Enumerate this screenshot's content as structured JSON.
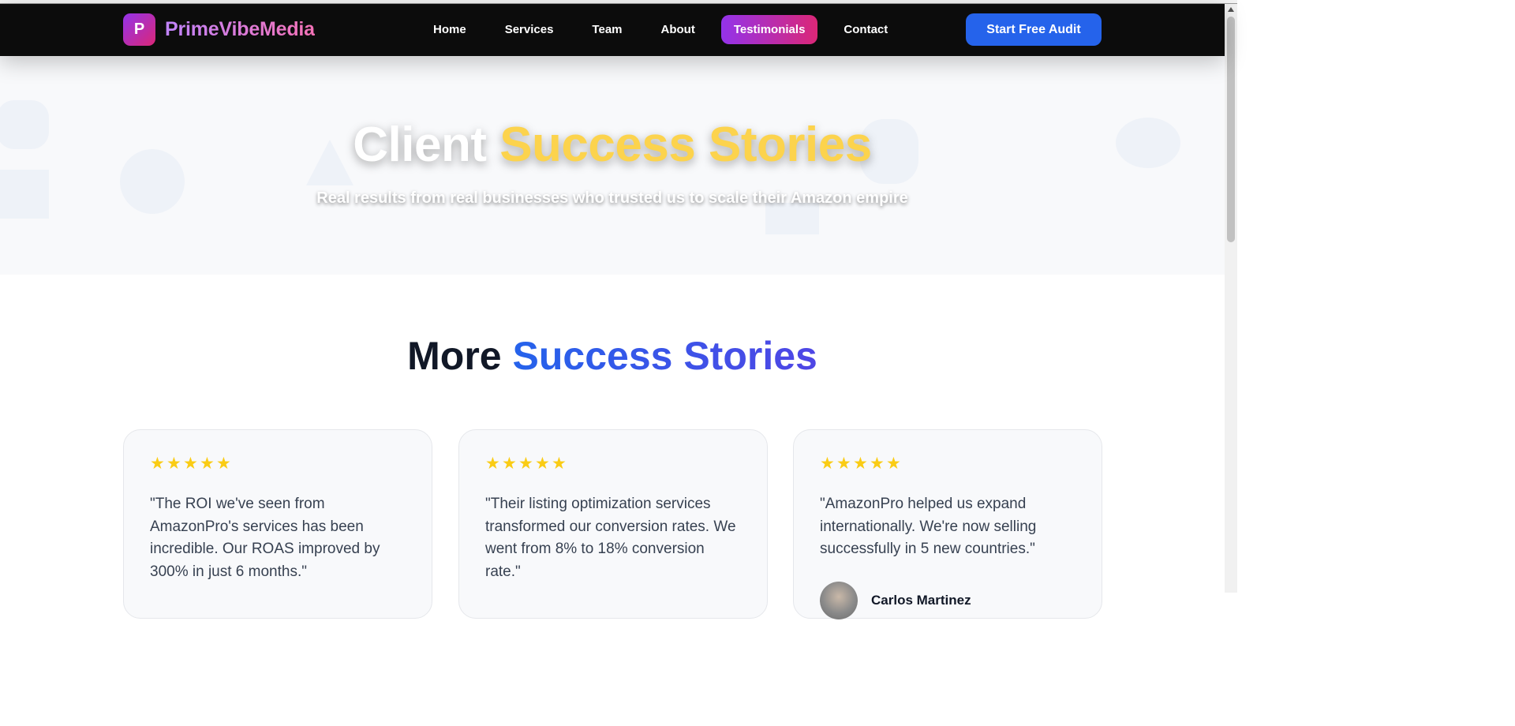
{
  "brand": {
    "logo_letter": "P",
    "name": "PrimeVibeMedia"
  },
  "nav": {
    "items": [
      {
        "label": "Home",
        "active": false
      },
      {
        "label": "Services",
        "active": false
      },
      {
        "label": "Team",
        "active": false
      },
      {
        "label": "About",
        "active": false
      },
      {
        "label": "Testimonials",
        "active": true
      },
      {
        "label": "Contact",
        "active": false
      }
    ],
    "cta_label": "Start Free Audit"
  },
  "hero": {
    "title_plain": "Client",
    "title_highlight": "Success Stories",
    "subtitle": "Real results from real businesses who trusted us to scale their Amazon empire"
  },
  "section": {
    "title_plain": "More",
    "title_highlight": "Success Stories"
  },
  "testimonials": [
    {
      "rating": 5,
      "quote": "\"The ROI we've seen from AmazonPro's services has been incredible. Our ROAS improved by 300% in just 6 months.\"",
      "author": ""
    },
    {
      "rating": 5,
      "quote": "\"Their listing optimization services transformed our conversion rates. We went from 8% to 18% conversion rate.\"",
      "author": ""
    },
    {
      "rating": 5,
      "quote": "\"AmazonPro helped us expand internationally. We're now selling successfully in 5 new countries.\"",
      "author": "Carlos Martinez"
    }
  ],
  "colors": {
    "nav_bg": "#0c0c0c",
    "accent_gradient_start": "#9333ea",
    "accent_gradient_end": "#db2777",
    "cta_blue": "#2563eb",
    "hero_highlight": "#fcd34d",
    "star": "#facc15"
  },
  "icons": {
    "star": "star-icon"
  }
}
